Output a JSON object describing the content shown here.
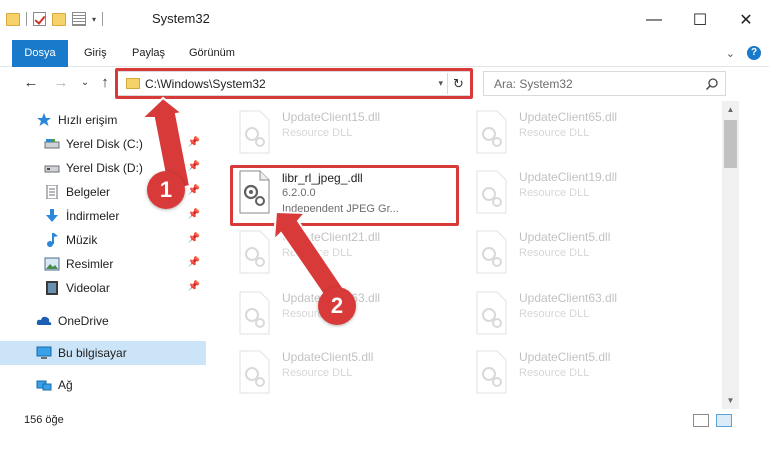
{
  "window": {
    "title": "System32",
    "controls": {
      "minimize": "—",
      "maximize": "☐",
      "close": "✕"
    }
  },
  "ribbon": {
    "tabs": [
      "Dosya",
      "Giriş",
      "Paylaş",
      "Görünüm"
    ],
    "chevron": "⌄",
    "help": "?"
  },
  "nav": {
    "back": "←",
    "forward": "→",
    "recent": "⌄",
    "up": "↑",
    "address": "C:\\Windows\\System32",
    "address_dropdown": "▾",
    "refresh": "↻",
    "search_placeholder": "Ara: System32"
  },
  "sidebar": {
    "items": [
      {
        "label": "Hızlı erişim",
        "icon": "star-icon",
        "pinned": false
      },
      {
        "label": "Yerel Disk (C:)",
        "icon": "drive-icon",
        "pinned": true
      },
      {
        "label": "Yerel Disk (D:)",
        "icon": "drive-icon",
        "pinned": true
      },
      {
        "label": "Belgeler",
        "icon": "documents-icon",
        "pinned": true
      },
      {
        "label": "İndirmeler",
        "icon": "download-icon",
        "pinned": true
      },
      {
        "label": "Müzik",
        "icon": "music-icon",
        "pinned": true
      },
      {
        "label": "Resimler",
        "icon": "pictures-icon",
        "pinned": true
      },
      {
        "label": "Videolar",
        "icon": "videos-icon",
        "pinned": true
      },
      {
        "label": "OneDrive",
        "icon": "cloud-icon",
        "pinned": false
      },
      {
        "label": "Bu bilgisayar",
        "icon": "computer-icon",
        "pinned": false,
        "selected": true
      },
      {
        "label": "Ağ",
        "icon": "network-icon",
        "pinned": false
      }
    ]
  },
  "files": {
    "highlighted": {
      "name": "libr_rl_jpeg_.dll",
      "version": "6.2.0.0",
      "description": "Independent JPEG Gr..."
    },
    "left_column": [
      {
        "name": "UpdateClient15.dll",
        "type": "Resource DLL"
      },
      {
        "name": "UpdateClient21.dll",
        "type": "Resource DLL"
      },
      {
        "name": "UpdateClient63.dll",
        "type": "Resource DLL"
      },
      {
        "name": "UpdateClient5.dll",
        "type": "Resource DLL"
      }
    ],
    "right_column": [
      {
        "name": "UpdateClient65.dll",
        "type": "Resource DLL"
      },
      {
        "name": "UpdateClient19.dll",
        "type": "Resource DLL"
      },
      {
        "name": "UpdateClient5.dll",
        "type": "Resource DLL"
      },
      {
        "name": "UpdateClient63.dll",
        "type": "Resource DLL"
      },
      {
        "name": "UpdateClient5.dll",
        "type": "Resource DLL"
      }
    ]
  },
  "callouts": [
    "1",
    "2"
  ],
  "status": {
    "count": "156 öğe"
  },
  "colors": {
    "accent": "#1979ca",
    "highlight": "#d83a3a",
    "selected": "#cce4f7"
  }
}
